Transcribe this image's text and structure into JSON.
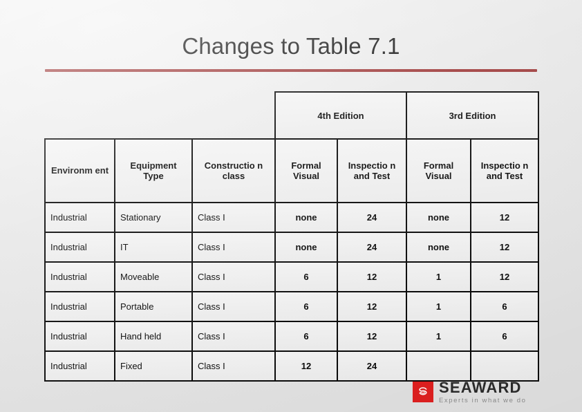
{
  "slide": {
    "title": "Changes to Table 7.1",
    "accent_color": "#9e3a3a",
    "background_color": "#e8e8e8"
  },
  "table": {
    "group_headers": [
      {
        "label": "",
        "span": 3
      },
      {
        "label": "4th Edition",
        "span": 2
      },
      {
        "label": "3rd Edition",
        "span": 2
      }
    ],
    "column_headers": [
      "Environm ent",
      "Equipment Type",
      "Constructio n class",
      "Formal Visual",
      "Inspectio n and Test",
      "Formal Visual",
      "Inspectio n and Test"
    ],
    "rows": [
      {
        "environment": "Industrial",
        "equipment_type": "Stationary",
        "construction_class": "Class I",
        "formal_visual_4th": "none",
        "inspection_test_4th": "24",
        "formal_visual_3rd": "none",
        "inspection_test_3rd": "12"
      },
      {
        "environment": "Industrial",
        "equipment_type": "IT",
        "construction_class": "Class I",
        "formal_visual_4th": "none",
        "inspection_test_4th": "24",
        "formal_visual_3rd": "none",
        "inspection_test_3rd": "12"
      },
      {
        "environment": "Industrial",
        "equipment_type": "Moveable",
        "construction_class": "Class I",
        "formal_visual_4th": "6",
        "inspection_test_4th": "12",
        "formal_visual_3rd": "1",
        "inspection_test_3rd": "12"
      },
      {
        "environment": "Industrial",
        "equipment_type": "Portable",
        "construction_class": "Class I",
        "formal_visual_4th": "6",
        "inspection_test_4th": "12",
        "formal_visual_3rd": "1",
        "inspection_test_3rd": "6"
      },
      {
        "environment": "Industrial",
        "equipment_type": "Hand held",
        "construction_class": "Class I",
        "formal_visual_4th": "6",
        "inspection_test_4th": "12",
        "formal_visual_3rd": "1",
        "inspection_test_3rd": "6"
      },
      {
        "environment": "Industrial",
        "equipment_type": "Fixed",
        "construction_class": "Class I",
        "formal_visual_4th": "12",
        "inspection_test_4th": "24",
        "formal_visual_3rd": "",
        "inspection_test_3rd": ""
      }
    ]
  },
  "logo": {
    "name": "SEAWARD",
    "tagline": "Experts in what we do",
    "mark_color": "#e02020",
    "mark_icon": "swirl-icon"
  }
}
